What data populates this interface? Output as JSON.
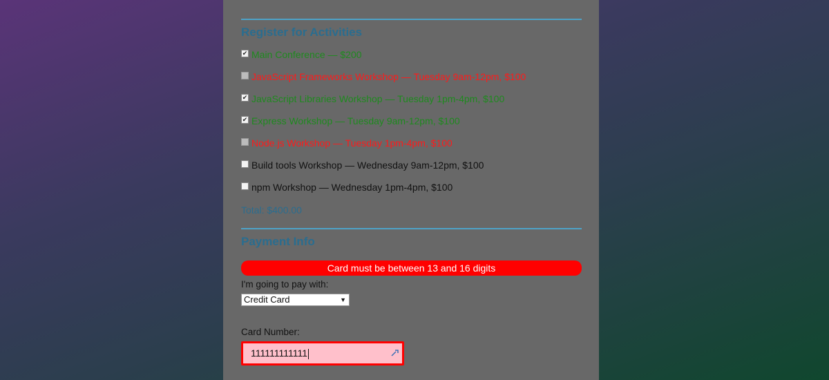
{
  "activities_section": {
    "title": "Register for Activities",
    "items": [
      {
        "label": "Main Conference — $200",
        "checked": true,
        "state": "selected"
      },
      {
        "label": "JavaScript Frameworks Workshop — Tuesday 9am-12pm, $100",
        "checked": false,
        "state": "conflict"
      },
      {
        "label": "JavaScript Libraries Workshop — Tuesday 1pm-4pm, $100",
        "checked": true,
        "state": "selected"
      },
      {
        "label": "Express Workshop — Tuesday 9am-12pm, $100",
        "checked": true,
        "state": "selected"
      },
      {
        "label": "Node.js Workshop — Tuesday 1pm-4pm, $100",
        "checked": false,
        "state": "conflict"
      },
      {
        "label": "Build tools Workshop — Wednesday 9am-12pm, $100",
        "checked": false,
        "state": "available"
      },
      {
        "label": "npm Workshop — Wednesday 1pm-4pm, $100",
        "checked": false,
        "state": "available"
      }
    ],
    "total": "Total: $400.00"
  },
  "payment_section": {
    "title": "Payment Info",
    "error": "Card must be between 13 and 16 digits",
    "pay_with_label": "I'm going to pay with:",
    "pay_with_value": "Credit Card",
    "card_number_label": "Card Number:",
    "card_number_value": "111111111111"
  },
  "colors": {
    "selected": "#1e8a1e",
    "conflict": "#ff1a1a",
    "section_title": "#2a6d8f",
    "error_bg": "#ff0000",
    "invalid_input_bg": "#ffc0cb"
  }
}
